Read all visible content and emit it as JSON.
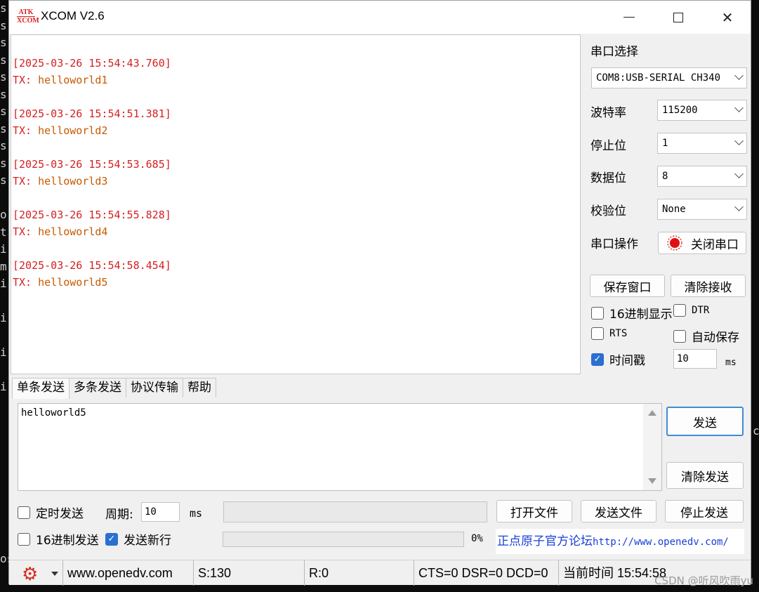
{
  "background": {
    "left_chars": [
      "s",
      "s",
      "s",
      "s",
      "s",
      "s",
      "s",
      "s",
      "s",
      "s",
      "s",
      "",
      "o",
      "t",
      "i",
      "m",
      "i",
      "",
      "i",
      "",
      "i",
      "",
      "i",
      "",
      "",
      "",
      "",
      "",
      "",
      "",
      "",
      "",
      "os"
    ],
    "right_char": "c",
    "watermark": "CSDN @听风吹雨yu"
  },
  "window": {
    "logo_top": "ATK",
    "logo_bottom": "XCOM",
    "title": "XCOM V2.6"
  },
  "receive": {
    "entries": [
      {
        "time": "[2025-03-26 15:54:43.760]",
        "tx_label": "TX:",
        "tx_value": "helloworld1"
      },
      {
        "time": "[2025-03-26 15:54:51.381]",
        "tx_label": "TX:",
        "tx_value": "helloworld2"
      },
      {
        "time": "[2025-03-26 15:54:53.685]",
        "tx_label": "TX:",
        "tx_value": "helloworld3"
      },
      {
        "time": "[2025-03-26 15:54:55.828]",
        "tx_label": "TX:",
        "tx_value": "helloworld4"
      },
      {
        "time": "[2025-03-26 15:54:58.454]",
        "tx_label": "TX:",
        "tx_value": "helloworld5"
      }
    ]
  },
  "settings": {
    "port_label": "串口选择",
    "port_value": "COM8:USB-SERIAL CH340",
    "baud_label": "波特率",
    "baud_value": "115200",
    "stop_label": "停止位",
    "stop_value": "1",
    "data_label": "数据位",
    "data_value": "8",
    "parity_label": "校验位",
    "parity_value": "None",
    "op_label": "串口操作",
    "close_port": "关闭串口",
    "save_window": "保存窗口",
    "clear_recv": "清除接收",
    "hex_display": "16进制显示",
    "dtr": "DTR",
    "rts": "RTS",
    "auto_save": "自动保存",
    "timestamp": "时间戳",
    "timestamp_value": "10",
    "ms": "ms"
  },
  "tabs": [
    "单条发送",
    "多条发送",
    "协议传输",
    "帮助"
  ],
  "send": {
    "text": "helloworld5",
    "send_button": "发送",
    "clear_send": "清除发送",
    "timed_send": "定时发送",
    "period_label": "周期:",
    "period_value": "10",
    "ms": "ms",
    "open_file": "打开文件",
    "send_file": "发送文件",
    "stop_send": "停止发送",
    "hex_send": "16进制发送",
    "newline": "发送新行",
    "progress": "0%",
    "forum_text": "正点原子官方论坛",
    "forum_url": "http://www.openedv.com/"
  },
  "statusbar": {
    "site": "www.openedv.com",
    "sent": "S:130",
    "recv": "R:0",
    "lines": "CTS=0 DSR=0 DCD=0",
    "time": "当前时间 15:54:58"
  },
  "colors": {
    "rx_red": "#d62020",
    "tx_orange": "#c85a00",
    "link_blue": "#1a3fd6",
    "accent": "#2b6fd1"
  }
}
